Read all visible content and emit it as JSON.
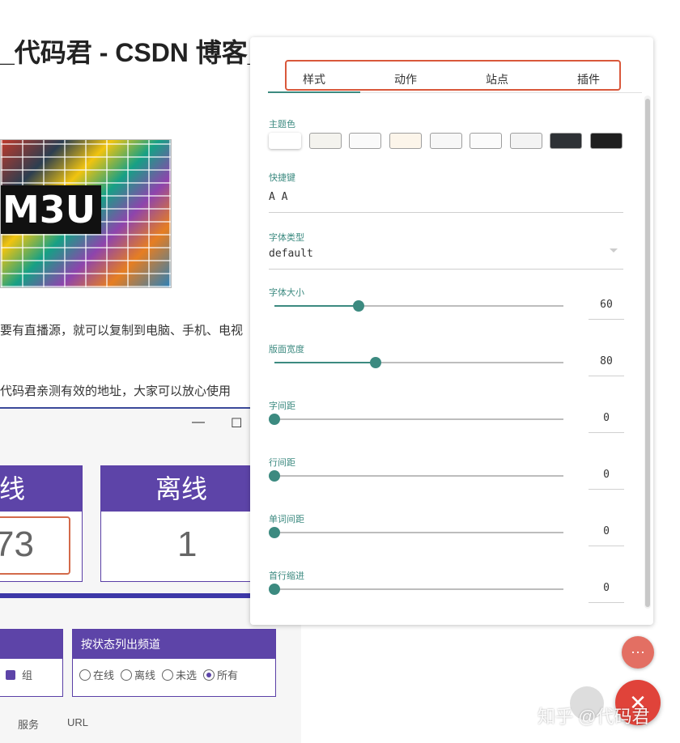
{
  "article": {
    "title": "_代码君 - CSDN 博客_",
    "image_label": "M3U",
    "line1": "要有直播源，就可以复制到电脑、手机、电视",
    "line2": "代码君亲测有效的地址，大家可以放心使用"
  },
  "app": {
    "minimize_glyph": "—",
    "maximize_glyph": "☐",
    "online_label": "线",
    "online_count": "73",
    "offline_label": "离线",
    "offline_count": "1",
    "group_panel": {
      "checkbox_label": "组"
    },
    "status_panel": {
      "title": "按状态列出频道",
      "options": [
        "在线",
        "离线",
        "未选",
        "所有"
      ],
      "selected": "所有"
    },
    "columns": [
      "服务",
      "URL"
    ]
  },
  "settings": {
    "tabs": [
      "样式",
      "动作",
      "站点",
      "插件"
    ],
    "active_tab": "样式",
    "theme": {
      "label": "主题色",
      "swatches": [
        "#ffffff",
        "#f4f3ee",
        "#fafafa",
        "#fcf5ea",
        "#f7f7f7",
        "#fbfbfb",
        "#f3f3f3",
        "#2e3135",
        "#1f1f1f"
      ]
    },
    "shortcut": {
      "label": "快捷键",
      "value": "A A"
    },
    "font_type": {
      "label": "字体类型",
      "value": "default"
    },
    "sliders": [
      {
        "label": "字体大小",
        "value": "60",
        "fraction": 0.29
      },
      {
        "label": "版面宽度",
        "value": "80",
        "fraction": 0.35
      },
      {
        "label": "字间距",
        "value": "0",
        "fraction": 0
      },
      {
        "label": "行间距",
        "value": "0",
        "fraction": 0
      },
      {
        "label": "单词间距",
        "value": "0",
        "fraction": 0
      },
      {
        "label": "首行缩进",
        "value": "0",
        "fraction": 0
      }
    ],
    "accent_color": "#3c8a80"
  },
  "fabs": {
    "more_glyph": "···",
    "close_glyph": "✕"
  },
  "watermark": "知乎 @代码君"
}
